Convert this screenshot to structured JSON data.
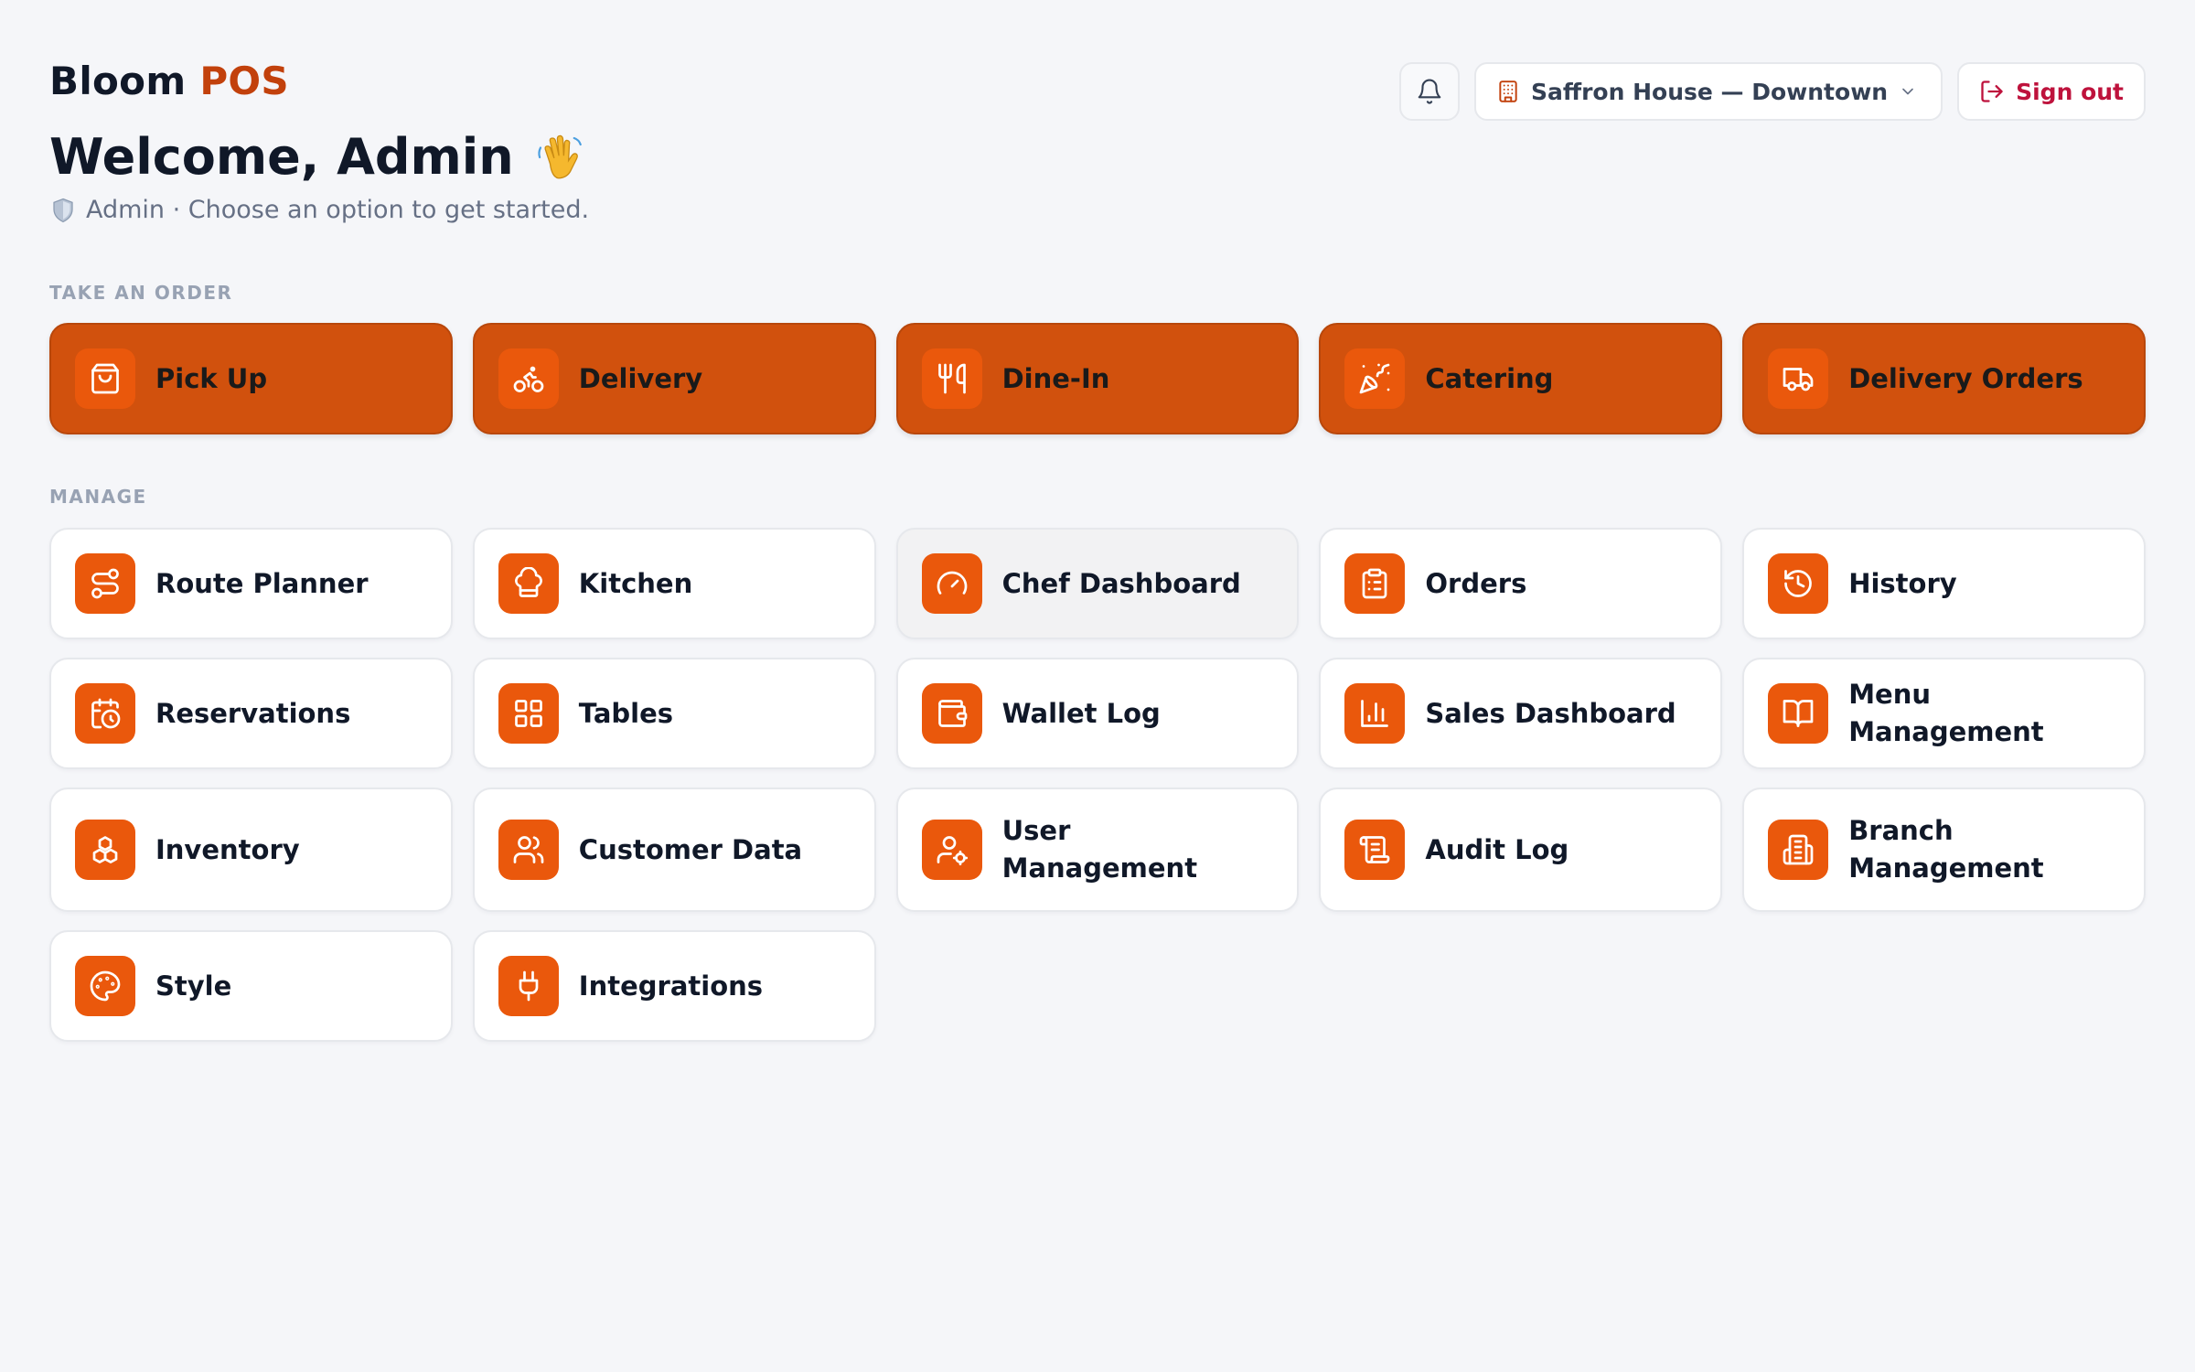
{
  "app": {
    "brand_main": "Bloom",
    "brand_accent": "POS",
    "accent_color": "#c2410c"
  },
  "header": {
    "welcome": "Welcome, Admin",
    "welcome_emoji": "waving-hand-icon",
    "role": "Admin",
    "subtitle": "Admin · Choose an option to get started."
  },
  "toolbar": {
    "branch": "Saffron House — Downtown",
    "signout": "Sign out"
  },
  "sections": {
    "order_title": "TAKE AN ORDER",
    "manage_title": "MANAGE"
  },
  "order_items": [
    {
      "label": "Pick Up",
      "icon": "shopping-bag-icon"
    },
    {
      "label": "Delivery",
      "icon": "bike-icon"
    },
    {
      "label": "Dine-In",
      "icon": "utensils-icon"
    },
    {
      "label": "Catering",
      "icon": "party-popper-icon"
    },
    {
      "label": "Delivery Orders",
      "icon": "truck-icon"
    }
  ],
  "manage_items": [
    {
      "label": "Route Planner",
      "icon": "route-icon"
    },
    {
      "label": "Kitchen",
      "icon": "chef-hat-icon"
    },
    {
      "label": "Chef Dashboard",
      "icon": "gauge-icon"
    },
    {
      "label": "Orders",
      "icon": "clipboard-icon"
    },
    {
      "label": "History",
      "icon": "history-icon"
    },
    {
      "label": "Reservations",
      "icon": "calendar-clock-icon"
    },
    {
      "label": "Tables",
      "icon": "grid-icon"
    },
    {
      "label": "Wallet Log",
      "icon": "wallet-icon"
    },
    {
      "label": "Sales Dashboard",
      "icon": "bar-chart-icon"
    },
    {
      "label": "Menu Management",
      "icon": "book-open-icon"
    },
    {
      "label": "Inventory",
      "icon": "boxes-icon"
    },
    {
      "label": "Customer Data",
      "icon": "users-icon"
    },
    {
      "label": "User Management",
      "icon": "user-cog-icon"
    },
    {
      "label": "Audit Log",
      "icon": "scroll-icon"
    },
    {
      "label": "Branch Management",
      "icon": "building-icon"
    },
    {
      "label": "Style",
      "icon": "palette-icon"
    },
    {
      "label": "Integrations",
      "icon": "plug-icon"
    }
  ],
  "colors": {
    "order_card_bg": "#d1510d",
    "icon_bg": "#ea580c",
    "signout_text": "#be123c",
    "page_bg": "#f5f6f9"
  }
}
